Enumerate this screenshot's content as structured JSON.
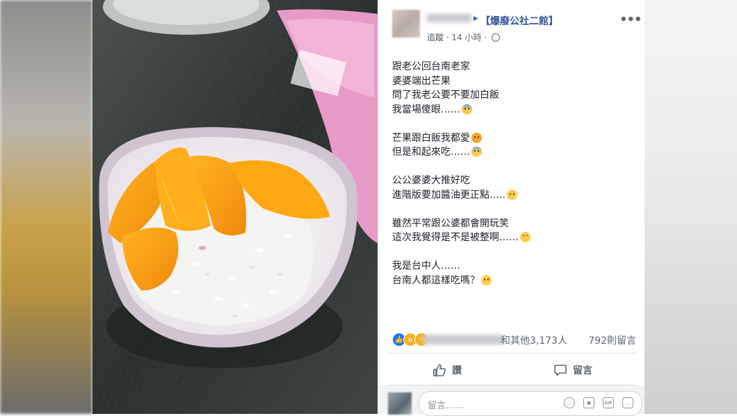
{
  "post": {
    "group_name": "【爆廢公社二館】",
    "meta": {
      "follow_label": "追蹤",
      "time": "14 小時"
    },
    "paragraphs": [
      [
        "跟老公回台南老家",
        "婆婆端出芒果",
        "問了我老公要不要加白飯",
        "我當場傻眼……"
      ],
      [
        "芒果跟白飯我都愛",
        "但是和起來吃……"
      ],
      [
        "公公婆婆大推好吃",
        "進階版要加醬油更正點….."
      ],
      [
        "雖然平常跟公婆都會開玩笑",
        "這次我覺得是不是被整啊……"
      ],
      [
        "我是台中人……",
        "台南人都這樣吃嗎？"
      ]
    ],
    "reactions": {
      "types": [
        "like-icon",
        "wow-icon",
        "haha-icon"
      ],
      "count_text": "和其他3,173人",
      "comments_text": "792則留言"
    },
    "actions": {
      "like_label": "讚",
      "comment_label": "留言"
    },
    "comment_box": {
      "placeholder": "留言……"
    }
  },
  "colors": {
    "link_blue": "#385898",
    "meta_gray": "#606770",
    "text": "#1d2129",
    "like_blue": "#1877f2",
    "emoji_yellow": "#ffcc4d"
  }
}
